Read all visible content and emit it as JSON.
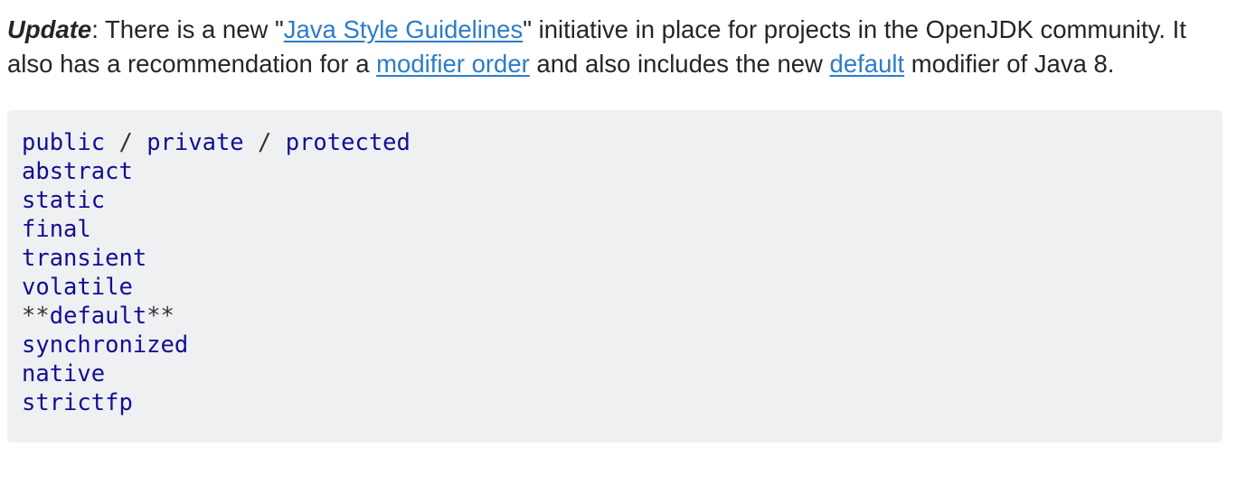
{
  "paragraph": {
    "bold_label": "Update",
    "segment_1": ": There is a new \"",
    "link_1": "Java Style Guidelines",
    "segment_2": "\" initiative in place for projects in the OpenJDK community. It also has a recommendation for a ",
    "link_2": "modifier order",
    "segment_3": " and also includes the new ",
    "link_3": "default",
    "segment_4": " modifier of Java 8."
  },
  "code": {
    "line_1": {
      "kw_a": "public",
      "sep_a": " / ",
      "kw_b": "private",
      "sep_b": " / ",
      "kw_c": "protected"
    },
    "lines": [
      "abstract",
      "static",
      "final",
      "transient",
      "volatile"
    ],
    "default_line": {
      "pre": "**",
      "word": "default",
      "post": "**"
    },
    "lines_after": [
      "synchronized",
      "native",
      "strictfp"
    ]
  },
  "colors": {
    "link": "#2d7cc9",
    "code_keyword": "#101094",
    "code_background": "#eff0f1",
    "text": "#232629"
  }
}
